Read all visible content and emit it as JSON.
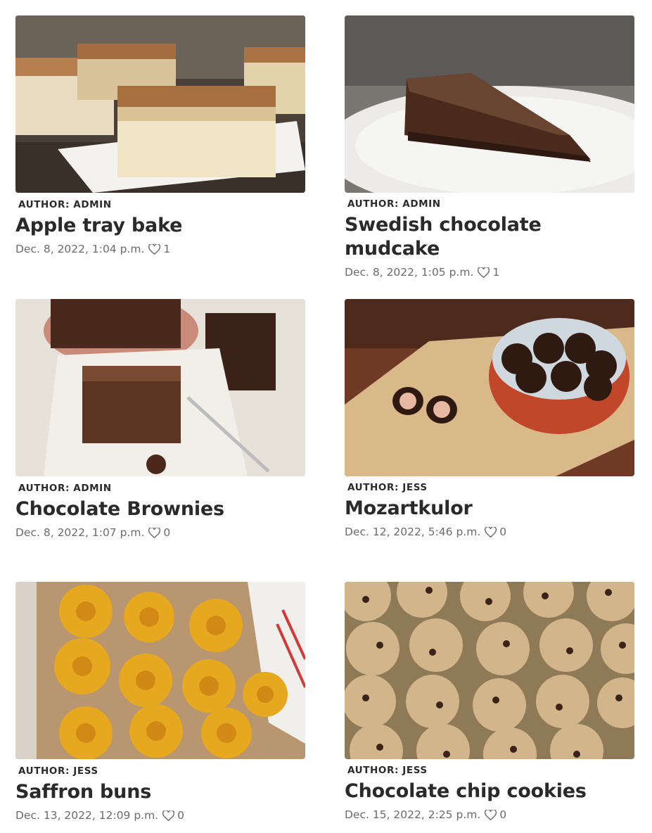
{
  "recipes": [
    {
      "author": "AUTHOR: ADMIN",
      "title": "Apple tray bake",
      "date": "Dec. 8, 2022, 1:04 p.m.",
      "likes": "1",
      "image_icon": "apple-tray-bake-photo"
    },
    {
      "author": "AUTHOR: ADMIN",
      "title": "Swedish chocolate mudcake",
      "date": "Dec. 8, 2022, 1:05 p.m.",
      "likes": "1",
      "image_icon": "mudcake-photo"
    },
    {
      "author": "AUTHOR: ADMIN",
      "title": "Chocolate Brownies",
      "date": "Dec. 8, 2022, 1:07 p.m.",
      "likes": "0",
      "image_icon": "brownies-photo"
    },
    {
      "author": "AUTHOR: JESS",
      "title": "Mozartkulor",
      "date": "Dec. 12, 2022, 5:46 p.m.",
      "likes": "0",
      "image_icon": "mozartkulor-photo"
    },
    {
      "author": "AUTHOR: JESS",
      "title": "Saffron buns",
      "date": "Dec. 13, 2022, 12:09 p.m.",
      "likes": "0",
      "image_icon": "saffron-buns-photo"
    },
    {
      "author": "AUTHOR: JESS",
      "title": "Chocolate chip cookies",
      "date": "Dec. 15, 2022, 2:25 p.m.",
      "likes": "0",
      "image_icon": "cookies-photo"
    }
  ]
}
